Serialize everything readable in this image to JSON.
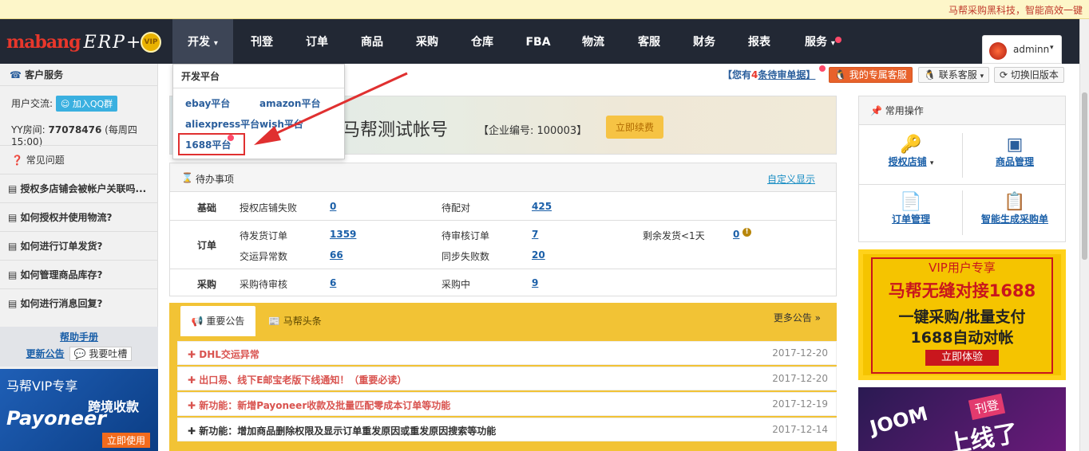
{
  "marquee": {
    "text": "马帮采购黑科技，智能高效一键"
  },
  "brand": {
    "logo": "mabang",
    "erp": "ERP+",
    "vip": "VIP"
  },
  "nav": {
    "items": [
      "开发",
      "刊登",
      "订单",
      "商品",
      "采购",
      "仓库",
      "FBA",
      "物流",
      "客服",
      "财务",
      "报表",
      "服务"
    ],
    "caret": "▾"
  },
  "user": {
    "name": "adminn"
  },
  "sidebar": {
    "service_title": "客户服务",
    "exchange_label": "用户交流:",
    "qq_group": "加入QQ群",
    "yy_label": "YY房间:",
    "yy_room": "77078476",
    "yy_time": "(每周四15:00)",
    "faq_title": "常见问题",
    "faqs": [
      "授权多店铺会被帐户关联吗...",
      "如何授权并使用物流?",
      "如何进行订单发货?",
      "如何管理商品库存?",
      "如何进行消息回复?"
    ],
    "help": "帮助手册",
    "updates": "更新公告",
    "feedback": "我要吐槽",
    "ad": {
      "title": "马帮VIP专享",
      "brand": "Payoneer",
      "tag": "跨境收款",
      "cta": "立即使用"
    }
  },
  "toolbar": {
    "pending_prefix": "【您有",
    "pending_count": "4",
    "pending_suffix": "条待审单据】",
    "exclusive": "我的专属客服",
    "contact": "联系客服",
    "switch": "切换旧版本"
  },
  "banner": {
    "account": "马帮测试帐号",
    "company": "【企业编号: 100003】",
    "renew": "立即续费"
  },
  "todo": {
    "title": "待办事项",
    "custom": "自定义显示",
    "rows": [
      {
        "group": "基础",
        "items": [
          [
            "授权店铺失败",
            "0"
          ],
          [
            "待配对",
            "425"
          ]
        ]
      },
      {
        "group": "订单",
        "items": [
          [
            "待发货订单",
            "1359"
          ],
          [
            "待审核订单",
            "7"
          ],
          [
            "剩余发货<1天",
            "0"
          ],
          [
            "交运异常数",
            "66"
          ],
          [
            "同步失败数",
            "20"
          ]
        ]
      },
      {
        "group": "采购",
        "items": [
          [
            "采购待审核",
            "6"
          ],
          [
            "采购中",
            "9"
          ]
        ]
      }
    ]
  },
  "news": {
    "tabs": [
      "重要公告",
      "马帮头条"
    ],
    "more": "更多公告 »",
    "items": [
      {
        "title": "DHL交运异常",
        "date": "2017-12-20",
        "color": "#d9534f"
      },
      {
        "title": "出口易、线下E邮宝老版下线通知！（重要必读）",
        "date": "2017-12-20",
        "color": "#d9534f"
      },
      {
        "title": "新功能：新增Payoneer收款及批量匹配零成本订单等功能",
        "date": "2017-12-19",
        "color": "#d9534f"
      },
      {
        "title": "新功能：增加商品删除权限及显示订单重发原因或重发原因搜索等功能",
        "date": "2017-12-14",
        "color": "#333333"
      }
    ]
  },
  "ops": {
    "title": "常用操作",
    "items": [
      "授权店铺",
      "商品管理",
      "订单管理",
      "智能生成采购单"
    ]
  },
  "ad1688": {
    "top": "VIP用户专享",
    "l1": "马帮无缝对接1688",
    "l2": "一键采购/批量支付",
    "l3": "1688自动对帐",
    "cta": "立即体验"
  },
  "joom": {
    "brand": "JOOM",
    "tag": "刊登",
    "big": "上线了"
  },
  "dropdown": {
    "title": "开发平台",
    "links": [
      "ebay平台",
      "amazon平台",
      "aliexpress平台",
      "wish平台",
      "1688平台"
    ]
  }
}
